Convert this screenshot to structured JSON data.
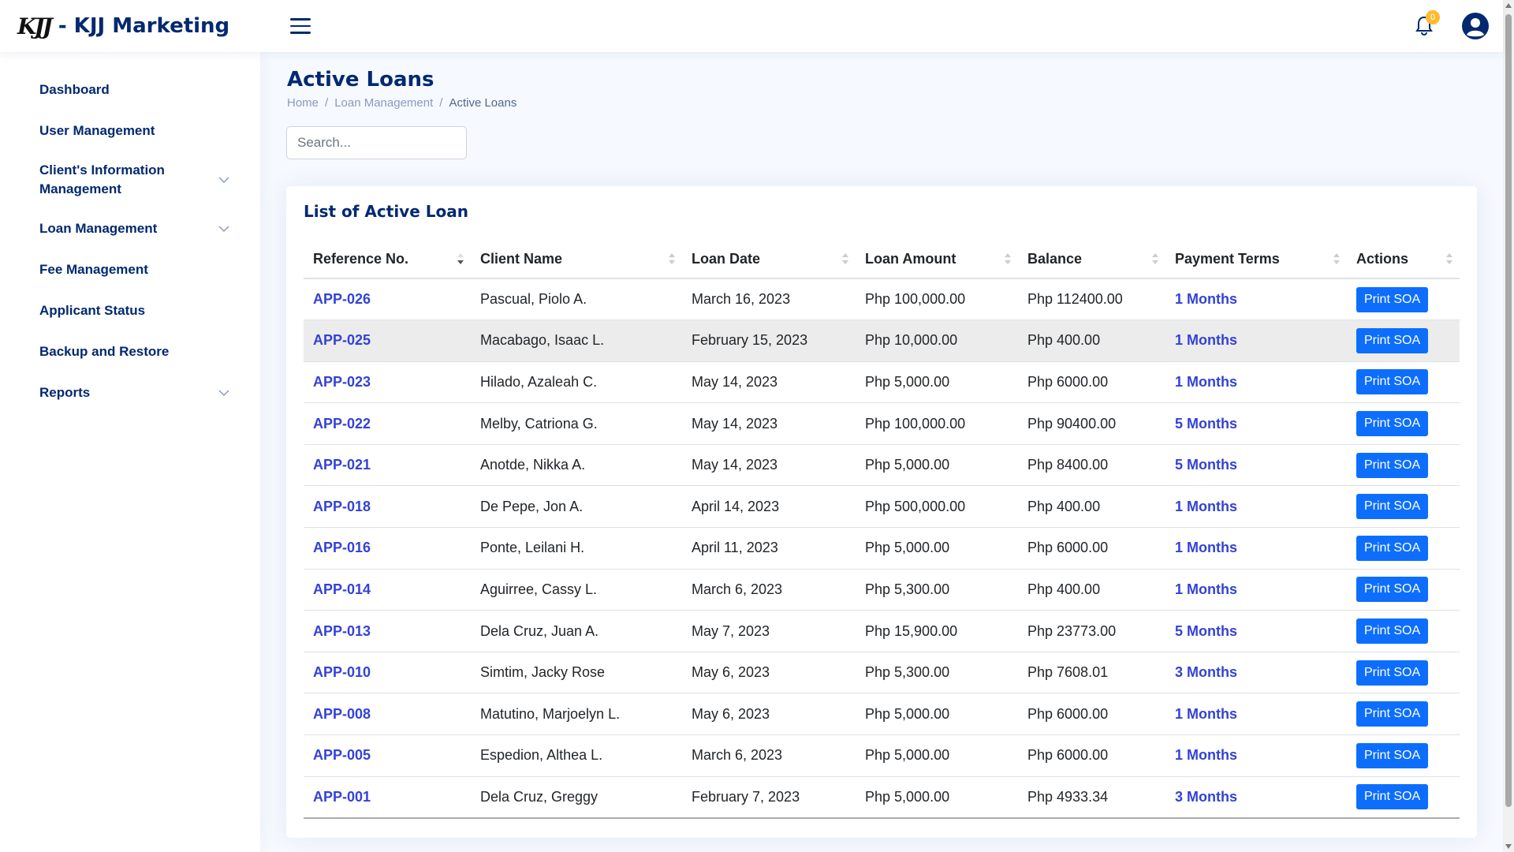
{
  "header": {
    "logo_mark": "KJJ",
    "brand": "- KJJ Marketing",
    "notification_count": "0"
  },
  "sidebar": {
    "items": [
      {
        "label": "Dashboard",
        "has_children": false
      },
      {
        "label": "User Management",
        "has_children": false
      },
      {
        "label": "Client's Information Management",
        "has_children": true
      },
      {
        "label": "Loan Management",
        "has_children": true
      },
      {
        "label": "Fee Management",
        "has_children": false
      },
      {
        "label": "Applicant Status",
        "has_children": false
      },
      {
        "label": "Backup and Restore",
        "has_children": false
      },
      {
        "label": "Reports",
        "has_children": true
      }
    ]
  },
  "page": {
    "title": "Active Loans",
    "breadcrumb": [
      "Home",
      "Loan Management",
      "Active Loans"
    ],
    "search_placeholder": "Search..."
  },
  "card": {
    "title": "List of Active Loan",
    "columns": [
      "Reference No.",
      "Client Name",
      "Loan Date",
      "Loan Amount",
      "Balance",
      "Payment Terms",
      "Actions"
    ],
    "action_label": "Print SOA",
    "rows": [
      {
        "ref": "APP-026",
        "client": "Pascual, Piolo A.",
        "date": "March 16, 2023",
        "amount": "Php 100,000.00",
        "balance": "Php 112400.00",
        "terms": "1 Months"
      },
      {
        "ref": "APP-025",
        "client": "Macabago, Isaac L.",
        "date": "February 15, 2023",
        "amount": "Php 10,000.00",
        "balance": "Php 400.00",
        "terms": "1 Months"
      },
      {
        "ref": "APP-023",
        "client": "Hilado, Azaleah C.",
        "date": "May 14, 2023",
        "amount": "Php 5,000.00",
        "balance": "Php 6000.00",
        "terms": "1 Months"
      },
      {
        "ref": "APP-022",
        "client": "Melby, Catriona G.",
        "date": "May 14, 2023",
        "amount": "Php 100,000.00",
        "balance": "Php 90400.00",
        "terms": "5 Months"
      },
      {
        "ref": "APP-021",
        "client": "Anotde, Nikka A.",
        "date": "May 14, 2023",
        "amount": "Php 5,000.00",
        "balance": "Php 8400.00",
        "terms": "5 Months"
      },
      {
        "ref": "APP-018",
        "client": "De Pepe, Jon A.",
        "date": "April 14, 2023",
        "amount": "Php 500,000.00",
        "balance": "Php 400.00",
        "terms": "1 Months"
      },
      {
        "ref": "APP-016",
        "client": "Ponte, Leilani H.",
        "date": "April 11, 2023",
        "amount": "Php 5,000.00",
        "balance": "Php 6000.00",
        "terms": "1 Months"
      },
      {
        "ref": "APP-014",
        "client": "Aguirree, Cassy L.",
        "date": "March 6, 2023",
        "amount": "Php 5,300.00",
        "balance": "Php 400.00",
        "terms": "1 Months"
      },
      {
        "ref": "APP-013",
        "client": "Dela Cruz, Juan A.",
        "date": "May 7, 2023",
        "amount": "Php 15,900.00",
        "balance": "Php 23773.00",
        "terms": "5 Months"
      },
      {
        "ref": "APP-010",
        "client": "Simtim, Jacky Rose",
        "date": "May 6, 2023",
        "amount": "Php 5,300.00",
        "balance": "Php 7608.01",
        "terms": "3 Months"
      },
      {
        "ref": "APP-008",
        "client": "Matutino, Marjoelyn L.",
        "date": "May 6, 2023",
        "amount": "Php 5,000.00",
        "balance": "Php 6000.00",
        "terms": "1 Months"
      },
      {
        "ref": "APP-005",
        "client": "Espedion, Althea L.",
        "date": "March 6, 2023",
        "amount": "Php 5,000.00",
        "balance": "Php 6000.00",
        "terms": "1 Months"
      },
      {
        "ref": "APP-001",
        "client": "Dela Cruz, Greggy",
        "date": "February 7, 2023",
        "amount": "Php 5,000.00",
        "balance": "Php 4933.34",
        "terms": "3 Months"
      }
    ]
  },
  "colors": {
    "brand_navy": "#012970",
    "link_blue": "#3342d6",
    "button_blue": "#0d6efd",
    "badge_yellow": "#ffbb2c"
  },
  "icons": [
    "hamburger-menu-icon",
    "bell-icon",
    "user-avatar-icon",
    "chevron-down-icon",
    "sort-icon"
  ]
}
